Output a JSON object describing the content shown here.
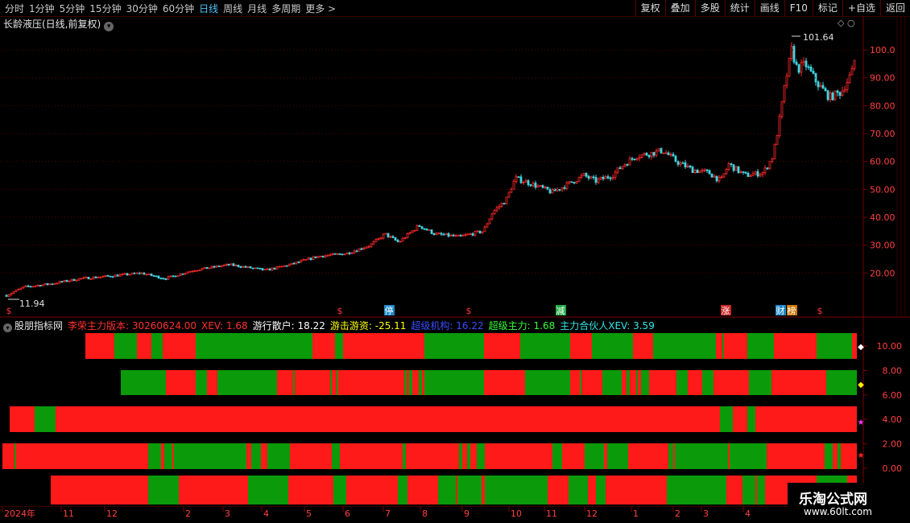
{
  "toolbar": {
    "periods": [
      "分时",
      "1分钟",
      "5分钟",
      "15分钟",
      "30分钟",
      "60分钟",
      "日线",
      "周线",
      "月线",
      "多周期",
      "更多 >"
    ],
    "active_period": "日线",
    "buttons": [
      "复权",
      "叠加",
      "多股",
      "统计",
      "画线",
      "F10",
      "标记",
      "+自选",
      "返回"
    ]
  },
  "main_chart": {
    "title": "长龄液压(日线,前复权)",
    "corner_icons": "◇ ○",
    "low_label": "11.94",
    "high_label": "101.64",
    "y_ticks": [
      "100.0",
      "90.00",
      "80.00",
      "70.00",
      "60.00",
      "50.00",
      "40.00",
      "30.00",
      "20.00"
    ],
    "events": [
      {
        "text": "$",
        "color": "#ff3333"
      },
      {
        "text": "$",
        "color": "#ff3333"
      },
      {
        "text": "停",
        "color": "#ffffff",
        "bg": "#1e88c8"
      },
      {
        "text": "$",
        "color": "#ff3333"
      },
      {
        "text": "减",
        "color": "#ffffff",
        "bg": "#22aa44"
      },
      {
        "text": "涨",
        "color": "#ffffff",
        "bg": "#cc2222"
      },
      {
        "text": "财",
        "color": "#ffffff",
        "bg": "#1e88c8"
      },
      {
        "text": "榜",
        "color": "#ffffff",
        "bg": "#cc7700"
      },
      {
        "text": "$",
        "color": "#ff3333"
      }
    ]
  },
  "indicator": {
    "name": "股朋指标网",
    "labels": [
      {
        "text": "李荣主力版本: 30260624.00",
        "color": "#ff3030"
      },
      {
        "text": "XEV: 1.68",
        "color": "#ff3030"
      },
      {
        "text": "游行散户: 18.22",
        "color": "#ffffff"
      },
      {
        "text": "游击游资: -25.11",
        "color": "#ffff00"
      },
      {
        "text": "超级机构: 16.22",
        "color": "#3a4cff"
      },
      {
        "text": "超级主力: 1.68",
        "color": "#33ff33"
      },
      {
        "text": "主力合伙人XEV: 3.59",
        "color": "#33e6e6"
      }
    ],
    "y_ticks": [
      "10.00",
      "8.00",
      "6.00",
      "4.00",
      "2.00",
      "0.00"
    ],
    "colors": {
      "red": "#ff1a1a",
      "green": "#0a9a0a"
    },
    "markers": [
      {
        "symbol": "◆",
        "color": "#ffffff"
      },
      {
        "symbol": "◆",
        "color": "#ffee00"
      },
      {
        "symbol": "★",
        "color": "#ff33ff"
      },
      {
        "symbol": "★",
        "color": "#ff2222"
      }
    ]
  },
  "x_axis": {
    "labels": [
      "2024年",
      "11",
      "12",
      "2",
      "3",
      "4",
      "5",
      "6",
      "7",
      "8",
      "9",
      "10",
      "11",
      "12",
      "1",
      "2",
      "3",
      "4"
    ]
  },
  "watermark": {
    "line1": "乐淘公式网",
    "line2": "www.60lt.com"
  }
}
